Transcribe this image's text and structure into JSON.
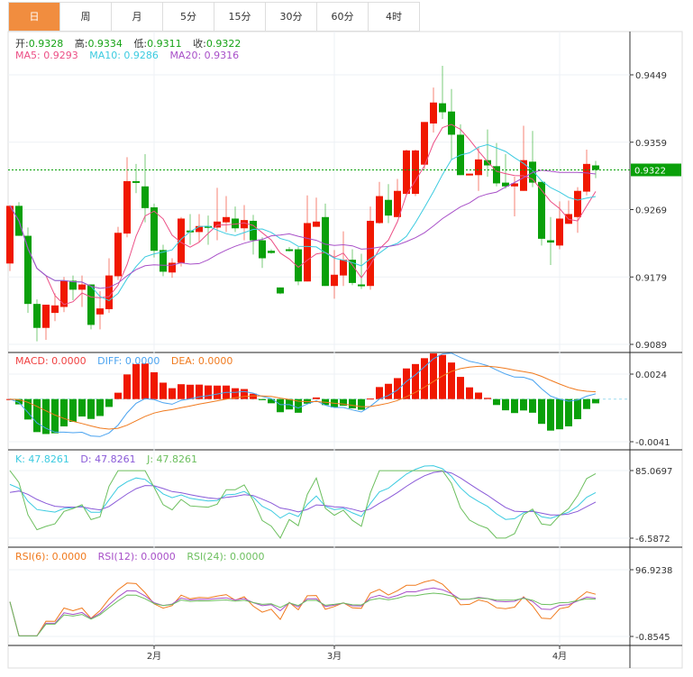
{
  "tabs": [
    {
      "label": "日",
      "active": true
    },
    {
      "label": "周"
    },
    {
      "label": "月"
    },
    {
      "label": "5分"
    },
    {
      "label": "15分"
    },
    {
      "label": "30分"
    },
    {
      "label": "60分"
    },
    {
      "label": "4时"
    }
  ],
  "ohlc_legend": {
    "open_label": "开:",
    "open": "0.9328",
    "high_label": "高:",
    "high": "0.9334",
    "low_label": "低:",
    "low": "0.9311",
    "close_label": "收:",
    "close": "0.9322"
  },
  "ma_legend": {
    "ma5": "MA5: 0.9293",
    "ma10": "MA10: 0.9286",
    "ma20": "MA20: 0.9316"
  },
  "macd_legend": {
    "macd": "MACD: 0.0000",
    "diff": "DIFF: 0.0000",
    "dea": "DEA: 0.0000"
  },
  "kdj_legend": {
    "k": "K: 47.8261",
    "d": "D: 47.8261",
    "j": "J: 47.8261"
  },
  "rsi_legend": {
    "rsi6": "RSI(6): 0.0000",
    "rsi12": "RSI(12): 0.0000",
    "rsi24": "RSI(24): 0.0000"
  },
  "price_tag": "0.9322",
  "colors": {
    "up": "#f01800",
    "down": "#0aa00a",
    "ma5": "#ec4f86",
    "ma10": "#3ccbe0",
    "ma20": "#a850c8",
    "tab_active": "#f18d3f",
    "diff": "#4aa3f0",
    "dea": "#f07a1e",
    "k": "#3ccbe0",
    "d": "#8a5ad8",
    "j": "#6cbf5e",
    "rsi6": "#f07a1e",
    "rsi12": "#a850c8",
    "rsi24": "#6cbf5e"
  },
  "chart_data": {
    "type": "candlestick",
    "price_axis": {
      "ticks": [
        "0.9449",
        "0.9359",
        "0.9269",
        "0.9179",
        "0.9089"
      ],
      "values": [
        0.9449,
        0.9359,
        0.9269,
        0.9179,
        0.9089
      ]
    },
    "macd_axis": {
      "ticks": [
        "0.0024",
        "-0.0041"
      ],
      "values": [
        0.0024,
        -0.0041
      ]
    },
    "kdj_axis": {
      "ticks": [
        "85.0697",
        "-6.5872"
      ],
      "values": [
        85.0697,
        -6.5872
      ]
    },
    "rsi_axis": {
      "ticks": [
        "96.9238",
        "-0.8545"
      ],
      "values": [
        96.9238,
        -0.8545
      ]
    },
    "x_labels": [
      {
        "label": "2月",
        "index": 16
      },
      {
        "label": "3月",
        "index": 36
      },
      {
        "label": "4月",
        "index": 61
      }
    ],
    "ohlc": [
      [
        0.9197,
        0.9275,
        0.9187,
        0.9274
      ],
      [
        0.9274,
        0.9279,
        0.9234,
        0.9234
      ],
      [
        0.9234,
        0.9245,
        0.9131,
        0.9143
      ],
      [
        0.9143,
        0.9149,
        0.9093,
        0.9111
      ],
      [
        0.9111,
        0.9142,
        0.9095,
        0.9142
      ],
      [
        0.9131,
        0.9157,
        0.912,
        0.9141
      ],
      [
        0.9139,
        0.9179,
        0.9132,
        0.9174
      ],
      [
        0.9174,
        0.9181,
        0.9148,
        0.9162
      ],
      [
        0.9162,
        0.9181,
        0.9139,
        0.9169
      ],
      [
        0.9169,
        0.9169,
        0.9109,
        0.9115
      ],
      [
        0.9129,
        0.916,
        0.9109,
        0.9137
      ],
      [
        0.9136,
        0.9204,
        0.9131,
        0.9181
      ],
      [
        0.918,
        0.9246,
        0.9175,
        0.9238
      ],
      [
        0.9237,
        0.9339,
        0.9232,
        0.9307
      ],
      [
        0.9307,
        0.933,
        0.9291,
        0.9305
      ],
      [
        0.93,
        0.9343,
        0.9252,
        0.9271
      ],
      [
        0.9272,
        0.9277,
        0.9205,
        0.9214
      ],
      [
        0.9215,
        0.9222,
        0.918,
        0.9186
      ],
      [
        0.9185,
        0.9204,
        0.9178,
        0.9198
      ],
      [
        0.9198,
        0.9259,
        0.9193,
        0.9257
      ],
      [
        0.9241,
        0.9263,
        0.9222,
        0.9239
      ],
      [
        0.9239,
        0.9263,
        0.9226,
        0.9247
      ],
      [
        0.9247,
        0.9261,
        0.9222,
        0.9245
      ],
      [
        0.9245,
        0.9298,
        0.9228,
        0.9253
      ],
      [
        0.9252,
        0.9287,
        0.9239,
        0.9259
      ],
      [
        0.9257,
        0.9273,
        0.9239,
        0.9244
      ],
      [
        0.9244,
        0.9275,
        0.9228,
        0.9255
      ],
      [
        0.9254,
        0.9262,
        0.9209,
        0.9228
      ],
      [
        0.9228,
        0.9232,
        0.9191,
        0.9204
      ],
      [
        0.9214,
        0.9216,
        0.921,
        0.9211
      ],
      [
        0.9165,
        0.9165,
        0.9156,
        0.9157
      ],
      [
        0.9216,
        0.9219,
        0.9213,
        0.9215
      ],
      [
        0.9216,
        0.9219,
        0.9168,
        0.9173
      ],
      [
        0.9173,
        0.9288,
        0.9173,
        0.9251
      ],
      [
        0.9246,
        0.9285,
        0.9246,
        0.9253
      ],
      [
        0.9259,
        0.9277,
        0.9167,
        0.9167
      ],
      [
        0.9167,
        0.9215,
        0.915,
        0.9182
      ],
      [
        0.9181,
        0.924,
        0.9167,
        0.9202
      ],
      [
        0.9202,
        0.9216,
        0.9168,
        0.9171
      ],
      [
        0.9169,
        0.921,
        0.9163,
        0.9168
      ],
      [
        0.9167,
        0.9273,
        0.9162,
        0.9254
      ],
      [
        0.9251,
        0.9306,
        0.925,
        0.9287
      ],
      [
        0.9282,
        0.9303,
        0.9251,
        0.9261
      ],
      [
        0.9259,
        0.931,
        0.9259,
        0.9294
      ],
      [
        0.929,
        0.9349,
        0.9288,
        0.9348
      ],
      [
        0.929,
        0.9349,
        0.9287,
        0.9348
      ],
      [
        0.9329,
        0.9386,
        0.9323,
        0.9386
      ],
      [
        0.9384,
        0.9432,
        0.9372,
        0.9412
      ],
      [
        0.9411,
        0.9461,
        0.939,
        0.9399
      ],
      [
        0.94,
        0.943,
        0.9336,
        0.9369
      ],
      [
        0.9369,
        0.9383,
        0.9315,
        0.9315
      ],
      [
        0.9315,
        0.9317,
        0.9315,
        0.9317
      ],
      [
        0.9315,
        0.9353,
        0.9294,
        0.9336
      ],
      [
        0.9335,
        0.9376,
        0.9313,
        0.9328
      ],
      [
        0.9327,
        0.9358,
        0.93,
        0.9304
      ],
      [
        0.9305,
        0.9343,
        0.9297,
        0.93
      ],
      [
        0.93,
        0.9313,
        0.926,
        0.9304
      ],
      [
        0.9294,
        0.9381,
        0.9294,
        0.9335
      ],
      [
        0.9333,
        0.9374,
        0.9299,
        0.9305
      ],
      [
        0.9306,
        0.9306,
        0.9221,
        0.923
      ],
      [
        0.9228,
        0.9259,
        0.9195,
        0.9225
      ],
      [
        0.9221,
        0.928,
        0.9216,
        0.9257
      ],
      [
        0.925,
        0.9281,
        0.925,
        0.9263
      ],
      [
        0.9259,
        0.9299,
        0.9238,
        0.9294
      ],
      [
        0.9293,
        0.9349,
        0.9288,
        0.933
      ],
      [
        0.9328,
        0.9334,
        0.9311,
        0.9322
      ]
    ]
  }
}
